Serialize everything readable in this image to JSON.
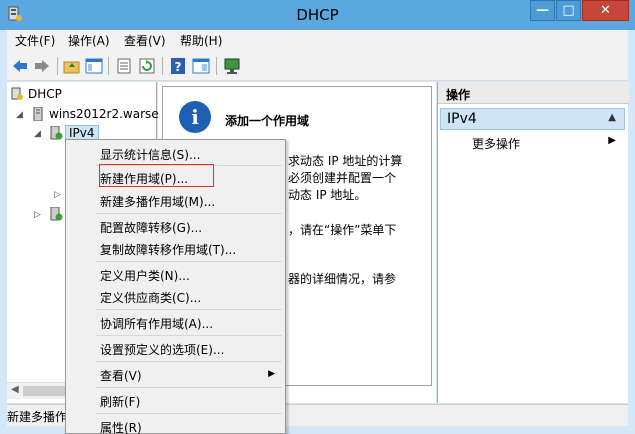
{
  "window": {
    "title": "DHCP",
    "controls": {
      "minimize": "—",
      "maximize": "□",
      "close": "✕"
    }
  },
  "menubar": [
    "文件(F)",
    "操作(A)",
    "查看(V)",
    "帮助(H)"
  ],
  "toolbar": [
    "back-icon",
    "forward-icon",
    "folder-up-icon",
    "show-hide-tree-icon",
    "properties-icon",
    "refresh-icon",
    "help-icon",
    "help-topics-icon",
    "monitor-icon"
  ],
  "tree": {
    "root": "DHCP",
    "server": "wins2012r2.warse",
    "ipv4": "IPv4"
  },
  "center": {
    "info_title": "添加一个作用域",
    "lines": [
      "求动态 IP 地址的计算",
      "必须创建并配置一个",
      "动态 IP 地址。",
      "，请在“操作”菜单下",
      "器的详细情况，请参"
    ]
  },
  "actions": {
    "header": "操作",
    "section": "IPv4",
    "more": "更多操作"
  },
  "context_menu": {
    "items": [
      "显示统计信息(S)...",
      "新建作用域(P)...",
      "新建多播作用域(M)...",
      "配置故障转移(G)...",
      "复制故障转移作用域(T)...",
      "定义用户类(N)...",
      "定义供应商类(C)...",
      "协调所有作用域(A)...",
      "设置预定义的选项(E)...",
      "查看(V)",
      "刷新(F)",
      "属性(R)"
    ],
    "highlighted": "新建作用域(P)..."
  },
  "status": {
    "text": "新建多播作"
  },
  "colors": {
    "titlebar": "#5ba7e0",
    "frame": "#d4e7f8",
    "close": "#c7463a",
    "highlight_border": "#e0302b",
    "section": "#cfe4f6"
  }
}
